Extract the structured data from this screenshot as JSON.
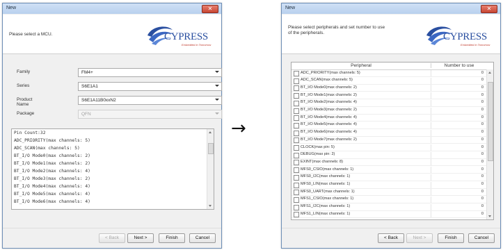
{
  "left_dialog": {
    "title": "New",
    "close_label": "✕",
    "instruction": "Please select a MCU.",
    "logo_text": "CYPRESS",
    "logo_tagline": "Embedded in Tomorrow",
    "fields": [
      {
        "label": "Family",
        "value": "FM4+",
        "disabled": false
      },
      {
        "label": "Series",
        "value": "S6E1A1",
        "disabled": false
      },
      {
        "label": "Product Name",
        "value": "S6E1A11B0xxN2",
        "disabled": false
      },
      {
        "label": "Package",
        "value": "QFN",
        "disabled": true
      }
    ],
    "info_lines": [
      "Pin Count:32",
      "ADC_PRIORITY(max channels: 5)",
      "ADC_SCAN(max channels: 5)",
      "BT_I/O Mode0(max channels: 2)",
      "BT_I/O Mode1(max channels: 2)",
      "BT_I/O Mode2(max channels: 4)",
      "BT_I/O Mode3(max channels: 2)",
      "BT_I/O Mode4(max channels: 4)",
      "BT_I/O Mode5(max channels: 4)",
      "BT_I/O Mode6(max channels: 4)"
    ],
    "buttons": {
      "back": "< Back",
      "next": "Next >",
      "finish": "Finish",
      "cancel": "Cancel"
    }
  },
  "transition_arrow": "→",
  "right_dialog": {
    "title": "New",
    "close_label": "✕",
    "instruction_line1": "Please select peripherals and set number to use",
    "instruction_line2": "of the peripherals.",
    "logo_text": "CYPRESS",
    "logo_tagline": "Embedded in Tomorrow",
    "columns": {
      "peripheral": "Peripheral",
      "number": "Number to use"
    },
    "rows": [
      {
        "name": "ADC_PRIORITY(max channels: 5)",
        "value": "0"
      },
      {
        "name": "ADC_SCAN(max channels: 5)",
        "value": "0"
      },
      {
        "name": "BT_I/O Mode0(max channels: 2)",
        "value": "0"
      },
      {
        "name": "BT_I/O Mode1(max channels: 2)",
        "value": "0"
      },
      {
        "name": "BT_I/O Mode2(max channels: 4)",
        "value": "0"
      },
      {
        "name": "BT_I/O Mode3(max channels: 2)",
        "value": "0"
      },
      {
        "name": "BT_I/O Mode4(max channels: 4)",
        "value": "0"
      },
      {
        "name": "BT_I/O Mode5(max channels: 4)",
        "value": "0"
      },
      {
        "name": "BT_I/O Mode6(max channels: 4)",
        "value": "0"
      },
      {
        "name": "BT_I/O Mode7(max channels: 2)",
        "value": "0"
      },
      {
        "name": "CLOCK(max pin: 5)",
        "value": "0"
      },
      {
        "name": "DEBUG(max pin: 2)",
        "value": "0"
      },
      {
        "name": "EXINT(max channels: 8)",
        "value": "0"
      },
      {
        "name": "MFS0_CSIO(max channels: 1)",
        "value": "0"
      },
      {
        "name": "MFS0_I2C(max channels: 1)",
        "value": "0"
      },
      {
        "name": "MFS0_LIN(max channels: 1)",
        "value": "0"
      },
      {
        "name": "MFS0_UART(max channels: 1)",
        "value": "0"
      },
      {
        "name": "MFS1_CSIO(max channels: 1)",
        "value": "0"
      },
      {
        "name": "MFS1_I2C(max channels: 1)",
        "value": "0"
      },
      {
        "name": "MFS1_LIN(max channels: 1)",
        "value": "0"
      }
    ],
    "buttons": {
      "back": "< Back",
      "next": "Next >",
      "finish": "Finish",
      "cancel": "Cancel"
    }
  }
}
